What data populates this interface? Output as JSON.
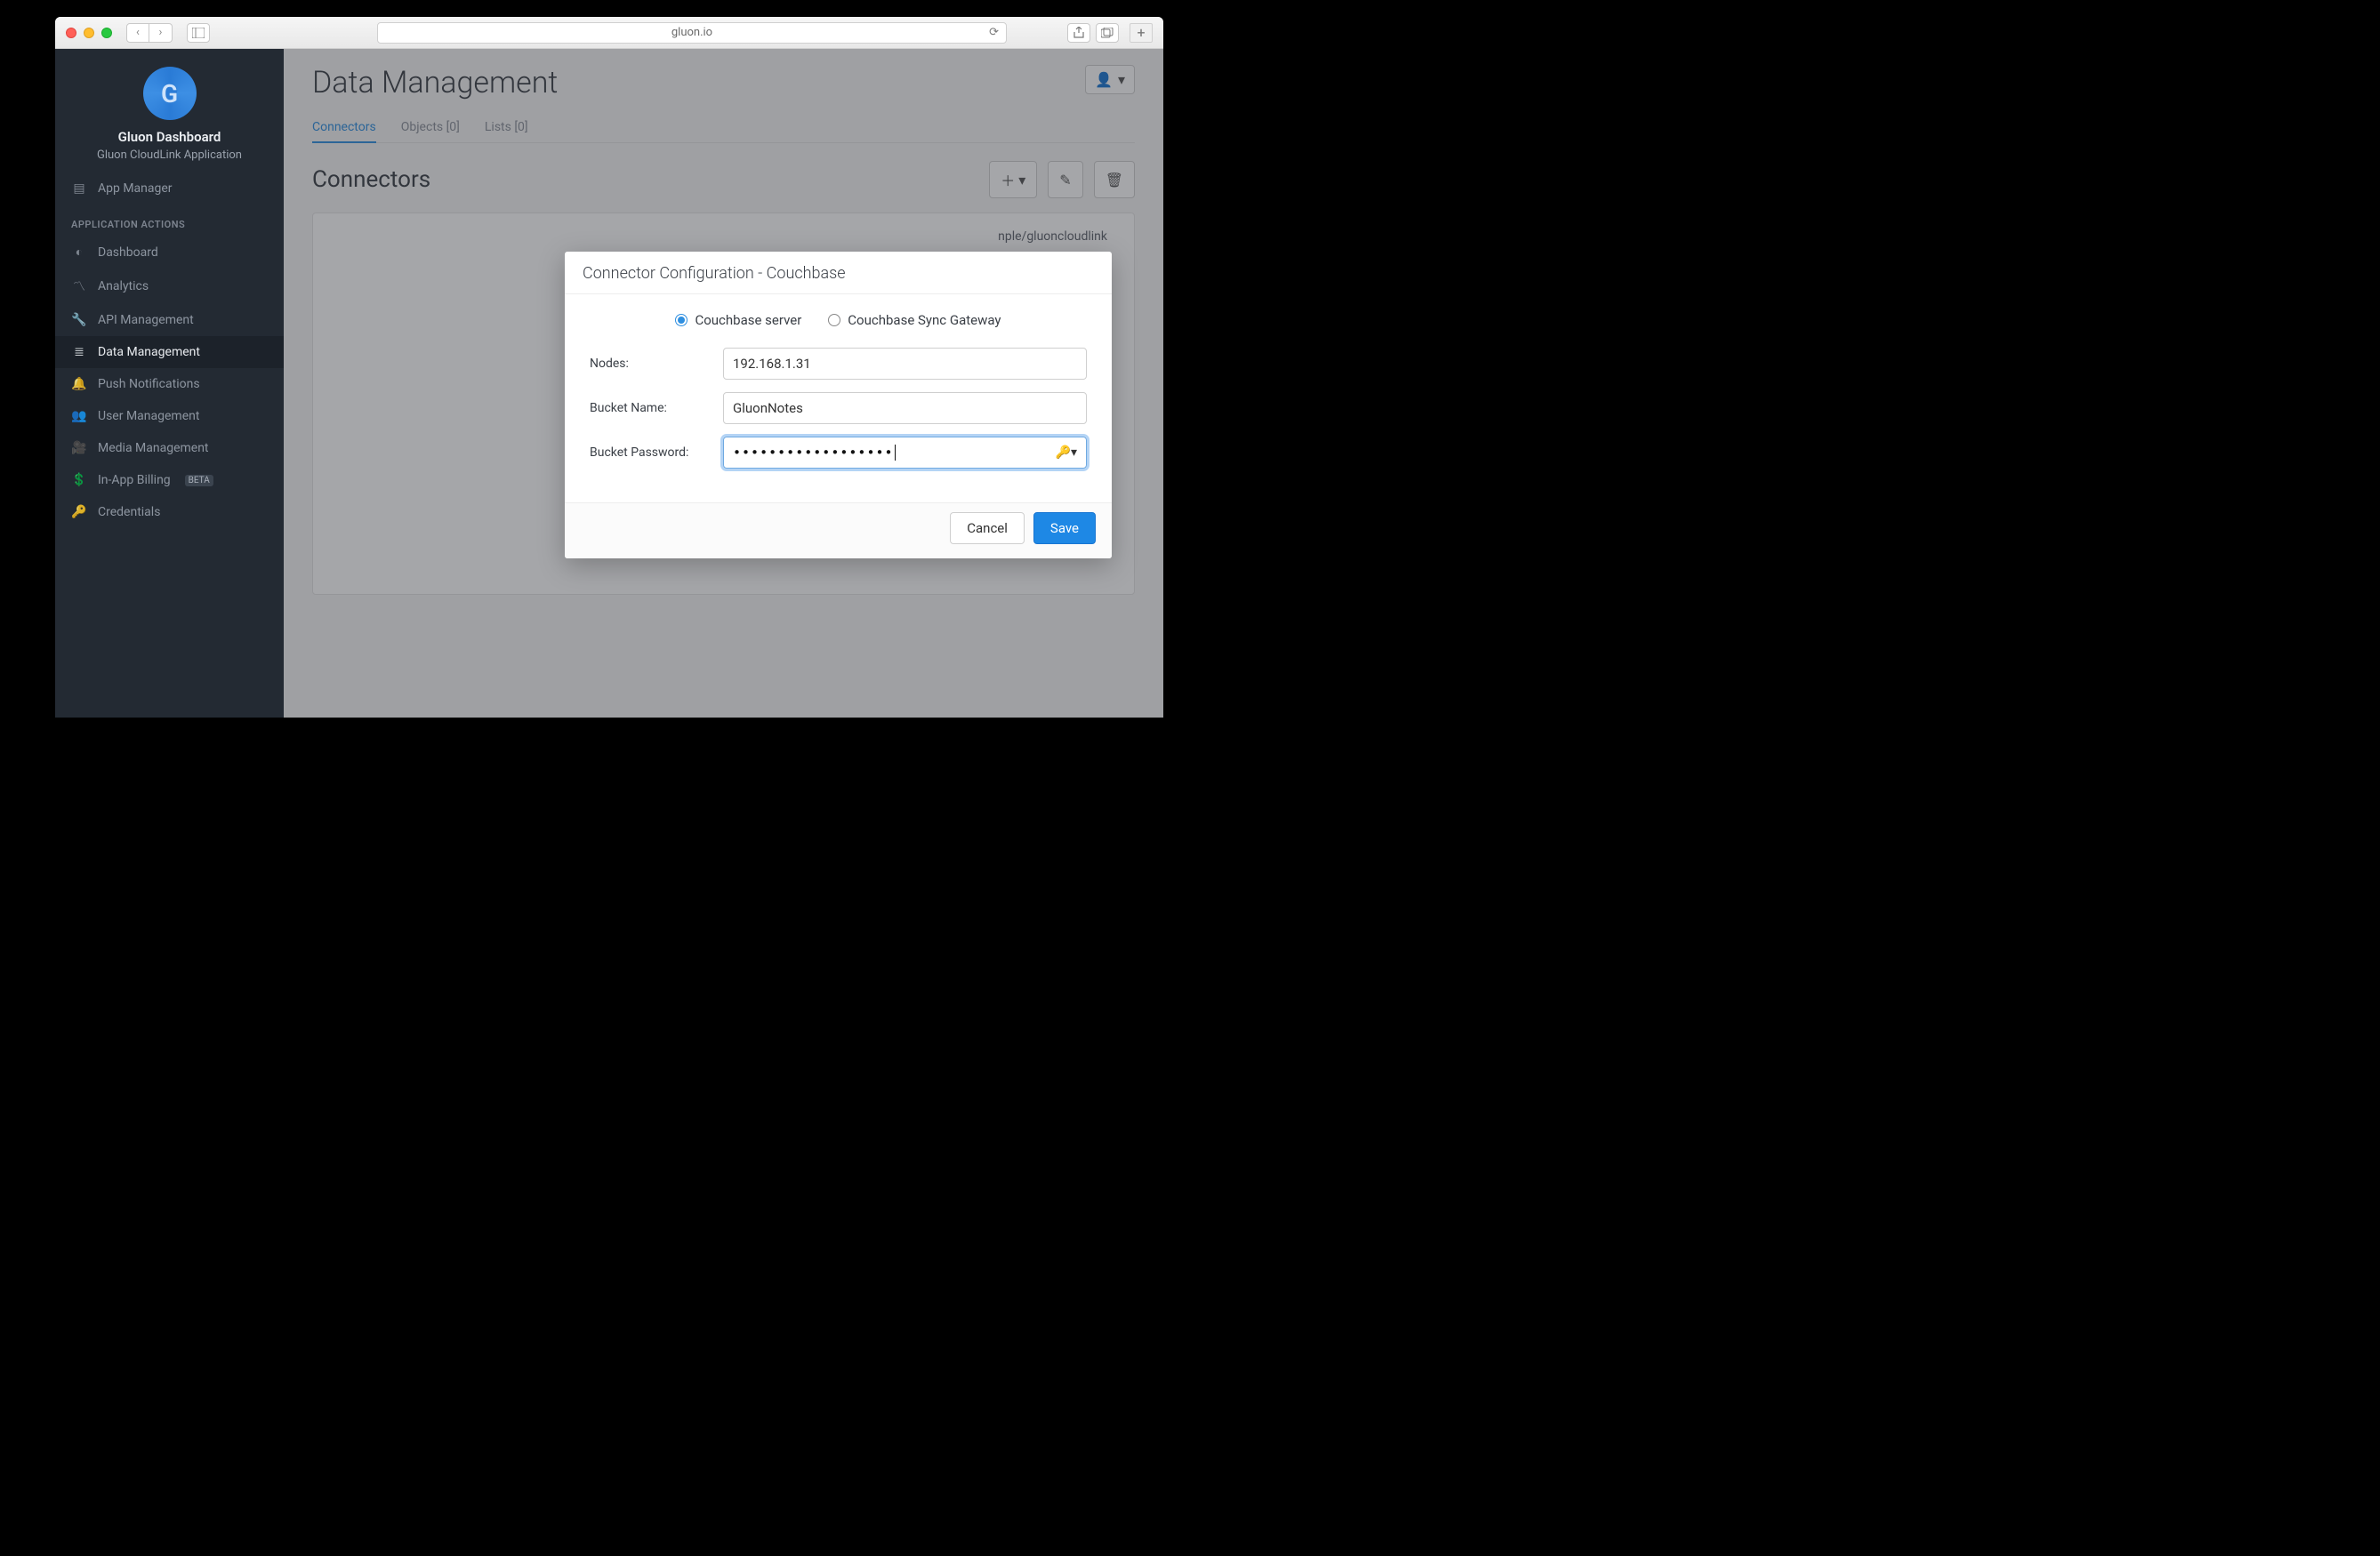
{
  "browser": {
    "url": "gluon.io"
  },
  "sidebar": {
    "title": "Gluon Dashboard",
    "subtitle": "Gluon CloudLink Application",
    "app_manager": "App Manager",
    "group_label": "APPLICATION ACTIONS",
    "items": [
      {
        "label": "Dashboard"
      },
      {
        "label": "Analytics"
      },
      {
        "label": "API Management"
      },
      {
        "label": "Data Management"
      },
      {
        "label": "Push Notifications"
      },
      {
        "label": "User Management"
      },
      {
        "label": "Media Management"
      },
      {
        "label": "In-App Billing"
      },
      {
        "label": "Credentials"
      }
    ],
    "beta_badge": "BETA"
  },
  "main": {
    "heading": "Data Management",
    "tabs": [
      {
        "label": "Connectors"
      },
      {
        "label": "Objects [0]"
      },
      {
        "label": "Lists [0]"
      }
    ],
    "section_title": "Connectors",
    "panel_hint": "nple/gluoncloudlink"
  },
  "modal": {
    "title": "Connector Configuration - Couchbase",
    "radio_server": "Couchbase server",
    "radio_sync": "Couchbase Sync Gateway",
    "label_nodes": "Nodes:",
    "label_bucket": "Bucket Name:",
    "label_pass": "Bucket Password:",
    "value_nodes": "192.168.1.31",
    "value_bucket": "GluonNotes",
    "value_pass": "••••••••••••••••••",
    "btn_cancel": "Cancel",
    "btn_save": "Save"
  }
}
